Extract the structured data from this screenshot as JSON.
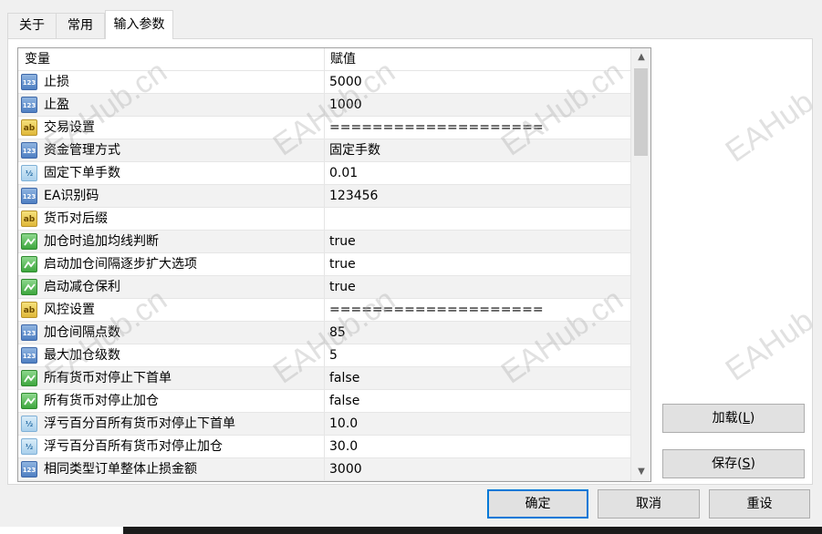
{
  "tabs": [
    {
      "label": "关于"
    },
    {
      "label": "常用"
    },
    {
      "label": "输入参数"
    }
  ],
  "grid": {
    "col_variable": "变量",
    "col_value": "赋值",
    "rows": [
      {
        "type": "int",
        "icon_text": "123",
        "name": "止损",
        "value": "5000"
      },
      {
        "type": "int",
        "icon_text": "123",
        "name": "止盈",
        "value": "1000"
      },
      {
        "type": "string",
        "icon_text": "ab",
        "name": "交易设置",
        "value": "===================="
      },
      {
        "type": "int",
        "icon_text": "123",
        "name": "资金管理方式",
        "value": "固定手数"
      },
      {
        "type": "double",
        "icon_text": "½",
        "name": "固定下单手数",
        "value": "0.01"
      },
      {
        "type": "int",
        "icon_text": "123",
        "name": "EA识别码",
        "value": "123456"
      },
      {
        "type": "string",
        "icon_text": "ab",
        "name": "货币对后缀",
        "value": ""
      },
      {
        "type": "bool",
        "icon_text": "",
        "name": "加仓时追加均线判断",
        "value": "true"
      },
      {
        "type": "bool",
        "icon_text": "",
        "name": "启动加仓间隔逐步扩大选项",
        "value": "true"
      },
      {
        "type": "bool",
        "icon_text": "",
        "name": "启动减仓保利",
        "value": "true"
      },
      {
        "type": "string",
        "icon_text": "ab",
        "name": "风控设置",
        "value": "===================="
      },
      {
        "type": "int",
        "icon_text": "123",
        "name": "加仓间隔点数",
        "value": "85"
      },
      {
        "type": "int",
        "icon_text": "123",
        "name": "最大加仓级数",
        "value": "5"
      },
      {
        "type": "bool",
        "icon_text": "",
        "name": "所有货币对停止下首单",
        "value": "false"
      },
      {
        "type": "bool",
        "icon_text": "",
        "name": "所有货币对停止加仓",
        "value": "false"
      },
      {
        "type": "double",
        "icon_text": "½",
        "name": "浮亏百分百所有货币对停止下首单",
        "value": "10.0"
      },
      {
        "type": "double",
        "icon_text": "½",
        "name": "浮亏百分百所有货币对停止加仓",
        "value": "30.0"
      },
      {
        "type": "int",
        "icon_text": "123",
        "name": "相同类型订单整体止损金额",
        "value": "3000"
      }
    ]
  },
  "buttons": {
    "load": {
      "label": "加载(",
      "key": "L",
      "close": ")"
    },
    "save": {
      "label": "保存(",
      "key": "S",
      "close": ")"
    },
    "ok": "确定",
    "cancel": "取消",
    "reset": "重设"
  },
  "watermark": {
    "text": "EAHub.cn",
    "short": "EAHub"
  },
  "colors": {
    "accent": "#0078d7",
    "row_alt": "#f2f2f2"
  }
}
